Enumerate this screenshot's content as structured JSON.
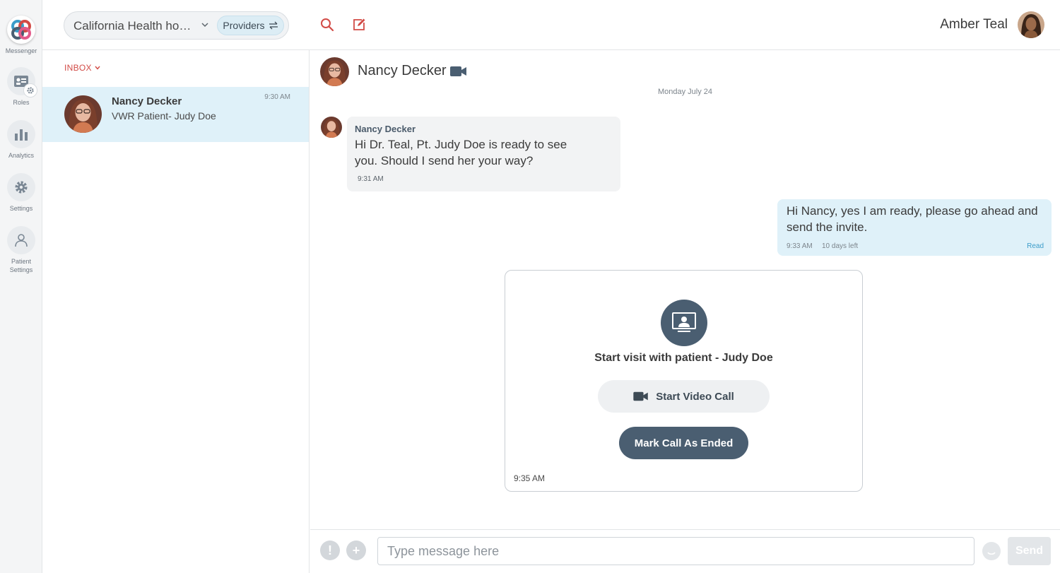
{
  "rail": {
    "logo_label": "Messenger",
    "items": [
      {
        "label": "Roles",
        "icon": "roles-icon"
      },
      {
        "label": "Analytics",
        "icon": "analytics-icon"
      },
      {
        "label": "Settings",
        "icon": "gear-icon"
      },
      {
        "label_line1": "Patient",
        "label_line2": "Settings",
        "icon": "patient-settings-icon"
      }
    ]
  },
  "topbar": {
    "org_name": "California Health hospital",
    "providers_label": "Providers",
    "user_name": "Amber Teal"
  },
  "inbox": {
    "label": "INBOX",
    "conversations": [
      {
        "name": "Nancy Decker",
        "preview": "VWR Patient- Judy Doe",
        "time": "9:30 AM"
      }
    ]
  },
  "chat": {
    "title": "Nancy Decker",
    "date_separator": "Monday July 24",
    "incoming": {
      "sender": "Nancy Decker",
      "text": "Hi Dr. Teal, Pt. Judy Doe is ready to see you.  Should I send her your way?",
      "time": "9:31 AM"
    },
    "outgoing": {
      "text": "Hi Nancy, yes I am ready, please go ahead and send the invite.",
      "time": "9:33 AM",
      "expiry": "10 days left",
      "status": "Read"
    },
    "visit_card": {
      "title": "Start visit with patient - Judy Doe",
      "start_video_label": "Start Video Call",
      "mark_ended_label": "Mark Call As Ended",
      "time": "9:35 AM"
    }
  },
  "composer": {
    "placeholder": "Type message here",
    "send_label": "Send",
    "priority_label": "!",
    "add_label": "+"
  },
  "colors": {
    "accent_red": "#d24b46",
    "selected_row": "#dff1f9",
    "primary_button": "#4a5e71"
  }
}
